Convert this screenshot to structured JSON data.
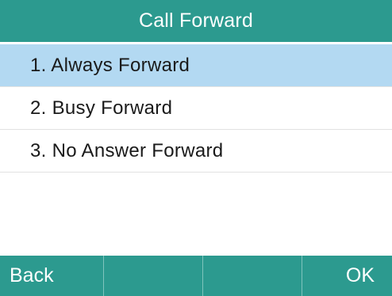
{
  "title": "Call Forward",
  "menu": {
    "items": [
      {
        "label": "1. Always Forward",
        "selected": true
      },
      {
        "label": "2. Busy Forward",
        "selected": false
      },
      {
        "label": "3. No Answer Forward",
        "selected": false
      }
    ]
  },
  "softkeys": {
    "key1": "Back",
    "key2": "",
    "key3": "",
    "key4": "OK"
  },
  "colors": {
    "header": "#2c9a8f",
    "selection": "#b3d9f2",
    "background": "#ffffff",
    "text": "#1a1a1a"
  }
}
